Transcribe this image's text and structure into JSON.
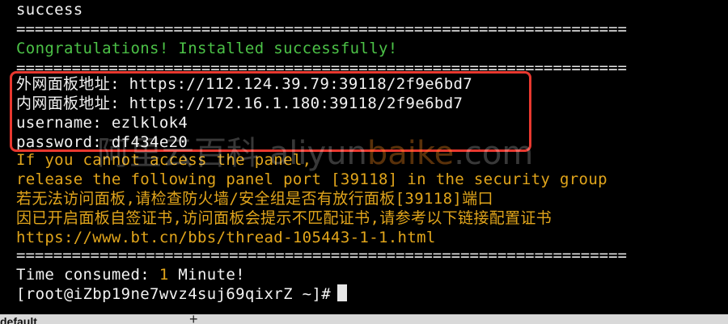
{
  "terminal": {
    "line_success": "success",
    "separator_1": "==================================================================",
    "congrats": "Congratulations! Installed successfully!",
    "separator_2": "==================================================================",
    "external_panel": "外网面板地址: https://112.124.39.79:39118/2f9e6bd7",
    "internal_panel": "内网面板地址: https://172.16.1.180:39118/2f9e6bd7",
    "username": "username: ezlklok4",
    "password": "password: df434e20",
    "warn_1": "If you cannot access the panel,",
    "warn_2": "release the following panel port [39118] in the security group",
    "warn_3": "若无法访问面板,请检查防火墙/安全组是否有放行面板[39118]端口",
    "warn_4": "因已开启面板自签证书,访问面板会提示不匹配证书,请参考以下链接配置证书",
    "warn_5": "https://www.bt.cn/bbs/thread-105443-1-1.html",
    "separator_3": "==================================================================",
    "time_label": "Time consumed: ",
    "time_value": "1",
    "time_unit": " Minute!",
    "prompt": "[root@iZbp19ne7wvz4suj69qixrZ ~]#"
  },
  "watermark": {
    "cn_text": "阿里云百科",
    "url_prefix": " aliyun",
    "url_accent": "baike",
    "url_suffix": ".com"
  },
  "tabbar": {
    "tab_label": "default",
    "add_icon": "+"
  },
  "colors": {
    "background": "#000000",
    "text": "#f2f2f2",
    "success_green": "#4cc247",
    "warning_yellow": "#e1a51b",
    "highlight_red": "#e8382f"
  }
}
